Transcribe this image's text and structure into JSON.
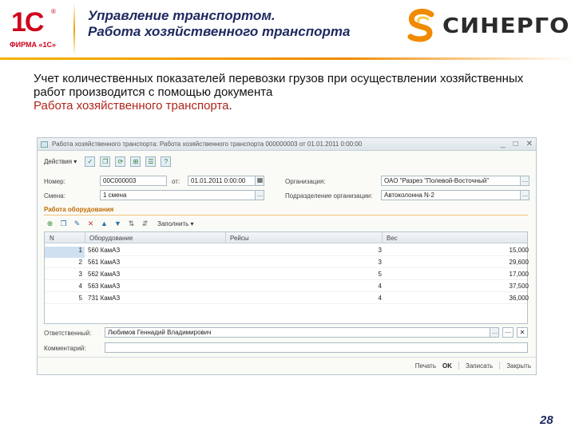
{
  "header": {
    "logo_mark": "1С",
    "logo_firm": "ФИРМА «1С»",
    "title_line1": "Управление транспортом.",
    "title_line2": "Работа хозяйственного транспорта",
    "partner_logo": "СИНЕРГО"
  },
  "description": {
    "text": "Учет количественных показателей перевозки грузов при осуществлении хозяйственных работ производится с помощью документа",
    "document_name": "Работа хозяйственного транспорта",
    "end": "."
  },
  "form": {
    "window_title": "Работа хозяйственного транспорта: Работа хозяйственного транспорта 000000003 от 01.01.2011 0:00:00",
    "toolbar": {
      "actions_label": "Действия"
    },
    "fields": {
      "number_label": "Номер:",
      "number_value": "00С000003",
      "date_label": "от:",
      "date_value": "01.01.2011 0:00:00",
      "organization_label": "Организация:",
      "organization_value": "ОАО \"Разрез \"Полевой-Восточный\"",
      "shift_label": "Смена:",
      "shift_value": "1 смена",
      "division_label": "Подразделение организации:",
      "division_value": "Автоколонна N-2"
    },
    "equipment_group_title": "Работа оборудования",
    "table_toolbar": {
      "fill_label": "Заполнить"
    },
    "table": {
      "columns": [
        "N",
        "Оборудование",
        "Рейсы",
        "Вес"
      ],
      "rows": [
        {
          "n": "1",
          "equipment": "560 КамАЗ",
          "trips": "3",
          "weight": "15,000"
        },
        {
          "n": "2",
          "equipment": "561 КамАЗ",
          "trips": "3",
          "weight": "29,600"
        },
        {
          "n": "3",
          "equipment": "562 КамАЗ",
          "trips": "5",
          "weight": "17,000"
        },
        {
          "n": "4",
          "equipment": "563 КамАЗ",
          "trips": "4",
          "weight": "37,500"
        },
        {
          "n": "5",
          "equipment": "731 КамАЗ",
          "trips": "4",
          "weight": "36,000"
        }
      ]
    },
    "responsible_label": "Ответственный:",
    "responsible_value": "Любимов Геннадий Владимирович",
    "comment_label": "Комментарий:",
    "comment_value": "",
    "footer": {
      "print_label": "Печать",
      "ok_label": "OK",
      "save_label": "Записать",
      "close_label": "Закрыть"
    }
  },
  "page_number": "28",
  "colors": {
    "brand_red": "#d0021b",
    "accent_orange": "#f08a00",
    "title_blue": "#1f2a60",
    "doc_link": "#b0261b"
  }
}
